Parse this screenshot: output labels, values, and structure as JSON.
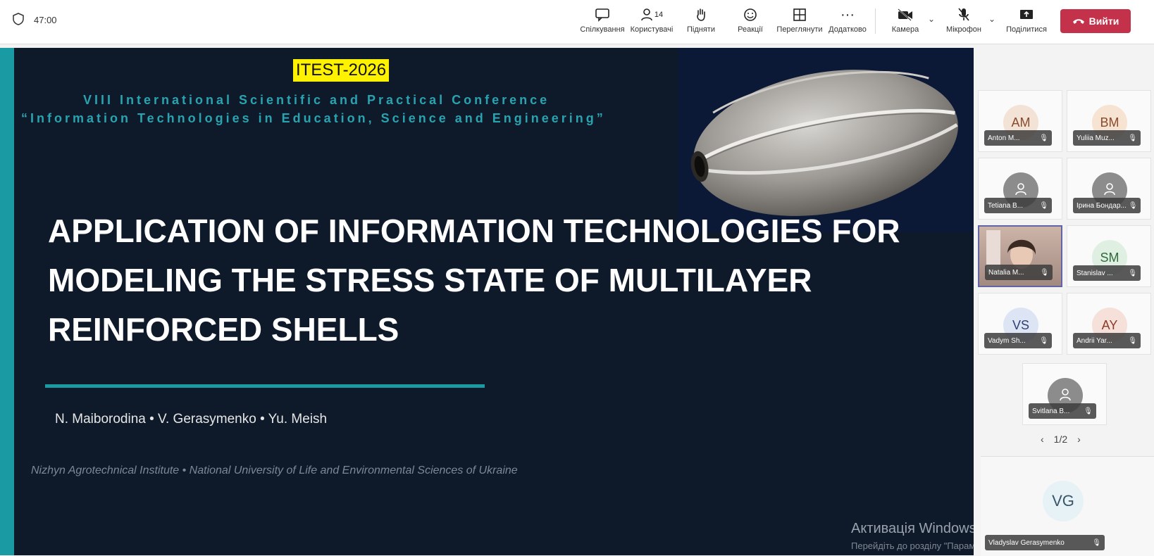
{
  "toolbar": {
    "time": "47:00",
    "buttons": {
      "chat": "Спілкування",
      "participants": "Користувачі",
      "participants_count": "14",
      "raise": "Підняти",
      "react": "Реакції",
      "view": "Переглянути",
      "more": "Додатково",
      "camera": "Камера",
      "mic": "Мікрофон",
      "share": "Поділитися"
    },
    "leave_label": "Вийти"
  },
  "slide": {
    "badge": "ITEST-2026",
    "conference_line1": "VIII International Scientific and Practical Conference",
    "conference_line2": "“Information Technologies in Education, Science and Engineering”",
    "title": "APPLICATION OF INFORMATION TECHNOLOGIES FOR MODELING THE STRESS STATE OF MULTILAYER REINFORCED SHELLS",
    "authors": "N. Maiborodina  •  V. Gerasymenko  •  Yu. Meish",
    "affiliation": "Nizhyn Agrotechnical Institute  •  National University of Life and Environmental Sciences of Ukraine"
  },
  "watermark": {
    "line1": "Активація Windows",
    "line2": "Перейдіть до розділу \"Параметри\", щоб активувати Windows."
  },
  "participants": [
    {
      "initials": "AM",
      "name": "Anton M...",
      "bg": "#f3e2d6",
      "fg": "#8a4b2a"
    },
    {
      "initials": "BM",
      "name": "Yuliia Muz...",
      "bg": "#f6e3d2",
      "fg": "#8a4b2a"
    },
    {
      "initials": "",
      "name": "Tetiana B...",
      "bg": "#8c8c8c",
      "fg": "#ffffff"
    },
    {
      "initials": "",
      "name": "Ірина Бондар...",
      "bg": "#8c8c8c",
      "fg": "#ffffff"
    },
    {
      "initials": "",
      "name": "Natalia M...",
      "bg": "",
      "fg": ""
    },
    {
      "initials": "SM",
      "name": "Stanislav ...",
      "bg": "#dff0e2",
      "fg": "#2f6a3a"
    },
    {
      "initials": "VS",
      "name": "Vadym Sh...",
      "bg": "#dde5f4",
      "fg": "#2f3f78"
    },
    {
      "initials": "AY",
      "name": "Andrii Yar...",
      "bg": "#f6e0da",
      "fg": "#8a3b2a"
    },
    {
      "initials": "",
      "name": "Svitlana B...",
      "bg": "#8c8c8c",
      "fg": "#ffffff"
    }
  ],
  "pager": "1/2",
  "self": {
    "initials": "VG",
    "name": "Vladyslav Gerasymenko"
  }
}
